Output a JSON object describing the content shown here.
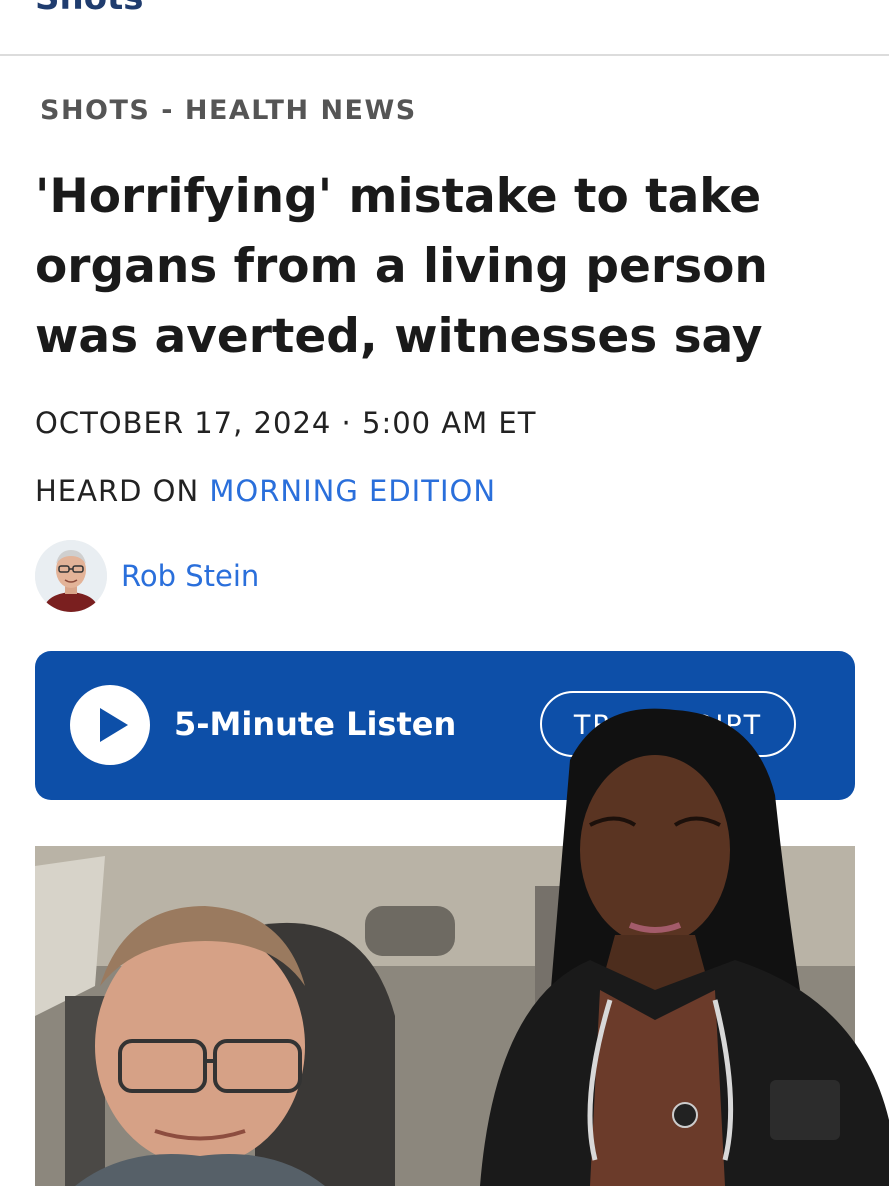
{
  "site": {
    "brand": "Shots"
  },
  "article": {
    "kicker": "SHOTS - HEALTH NEWS",
    "headline": "'Horrifying' mistake to take organs from a living person was averted, witnesses say",
    "dateline": "OCTOBER 17, 2024 · 5:00 AM ET",
    "heard_on_prefix": "HEARD ON ",
    "heard_on_show": "MORNING EDITION",
    "author": "Rob Stein"
  },
  "player": {
    "listen_label": "5-Minute Listen",
    "transcript_label": "TRANSCRIPT",
    "play_icon": "play-icon"
  },
  "colors": {
    "accent_blue": "#2a6fdb",
    "player_bg": "#0d4fa8",
    "brand_navy": "#1f3c6e"
  }
}
